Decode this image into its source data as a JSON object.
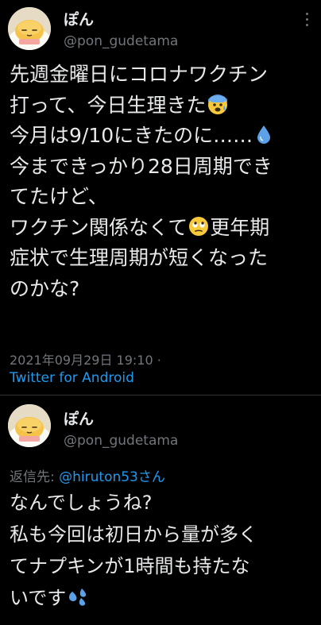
{
  "tweets": [
    {
      "display_name": "ぽん",
      "handle": "@pon_gudetama",
      "lines": [
        "先週金曜日にコロナワクチン",
        "打って、今日生理きた",
        "今月は9/10にきたのに……",
        "今まできっかり28日周期でき",
        "てたけど、",
        "ワクチン関係なくて",
        "更年期",
        "症状で生理周期が短くなった",
        "のかな?"
      ],
      "timestamp": "2021年09月29日 19:10 ·",
      "source": "Twitter for Android",
      "emojis": [
        "anxious-face-emoji",
        "droplet-emoji",
        "face-with-rolling-eyes-emoji"
      ]
    },
    {
      "display_name": "ぽん",
      "handle": "@pon_gudetama",
      "reply_prefix": "返信先: ",
      "reply_mention": "@hiruton53さん",
      "lines": [
        "なんでしょうね?",
        "私も今回は初日から量が多く",
        "てナプキンが1時間も持たな",
        "いです"
      ],
      "emojis": [
        "sweat-droplets-emoji"
      ]
    }
  ],
  "colors": {
    "background": "#000000",
    "text": "#e7e9ea",
    "secondary": "#71767b",
    "link": "#1d9bf0",
    "divider": "#2f3336"
  }
}
